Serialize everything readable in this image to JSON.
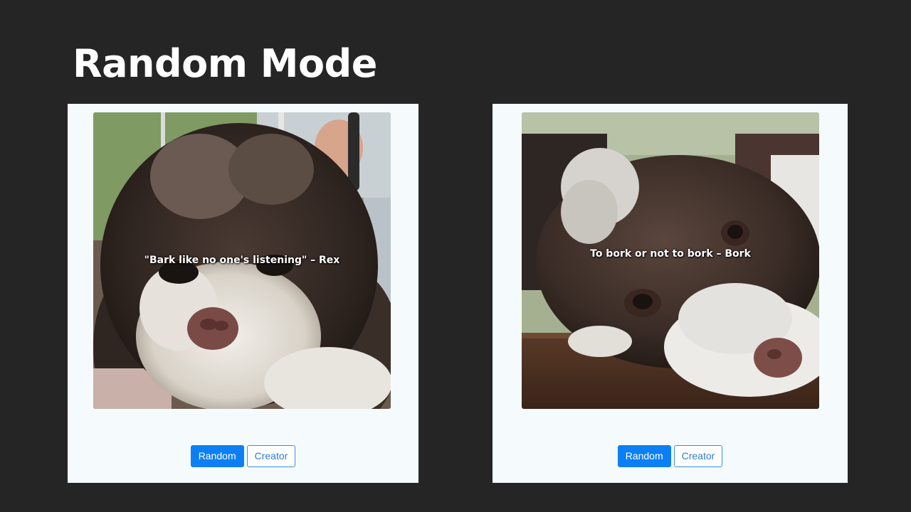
{
  "slide": {
    "title": "Random Mode"
  },
  "screens": [
    {
      "caption": "\"Bark like no one's listening\"  –  Rex",
      "buttons": {
        "random_label": "Random",
        "creator_label": "Creator"
      }
    },
    {
      "caption": "To bork or not to bork  –  Bork",
      "buttons": {
        "random_label": "Random",
        "creator_label": "Creator"
      }
    }
  ],
  "colors": {
    "background": "#252525",
    "panel": "#f5fbfd",
    "primary": "#0d7ff5",
    "outline": "#3b8fd9"
  }
}
